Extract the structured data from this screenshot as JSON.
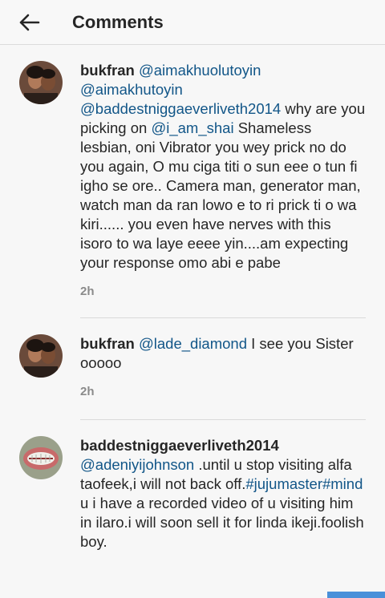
{
  "header": {
    "title": "Comments",
    "back_icon": "arrow-left-icon"
  },
  "comments": [
    {
      "user": "bukfran",
      "mentions": [
        "@aimakhuolutoyin",
        "@aimakhutoyin",
        "@baddestniggaeverliveth2014"
      ],
      "text1": " why are you picking on ",
      "mention2": "@i_am_shai",
      "text2": " Shameless lesbian, oni Vibrator you wey prick no do you again, O mu ciga titi o sun eee o tun fi igho se ore.. Camera  man, generator man, watch man da ran lowo e to ri prick ti o wa kiri...... you even have nerves with this isoro to wa laye eeee yin....am expecting your response omo abi e pabe",
      "time": "2h"
    },
    {
      "user": "bukfran",
      "mention": "@lade_diamond",
      "text": " I see you Sister ooooo",
      "time": "2h"
    },
    {
      "user": "baddestniggaeverliveth2014",
      "mention": "@adeniyijohnson",
      "text1": " .until u stop visiting alfa taofeek,i will not back off.",
      "hashtag": "#jujumaster#mind",
      "text2": " u i have a recorded video of u visiting him in ilaro.i will soon sell it for linda ikeji.foolish boy."
    }
  ]
}
